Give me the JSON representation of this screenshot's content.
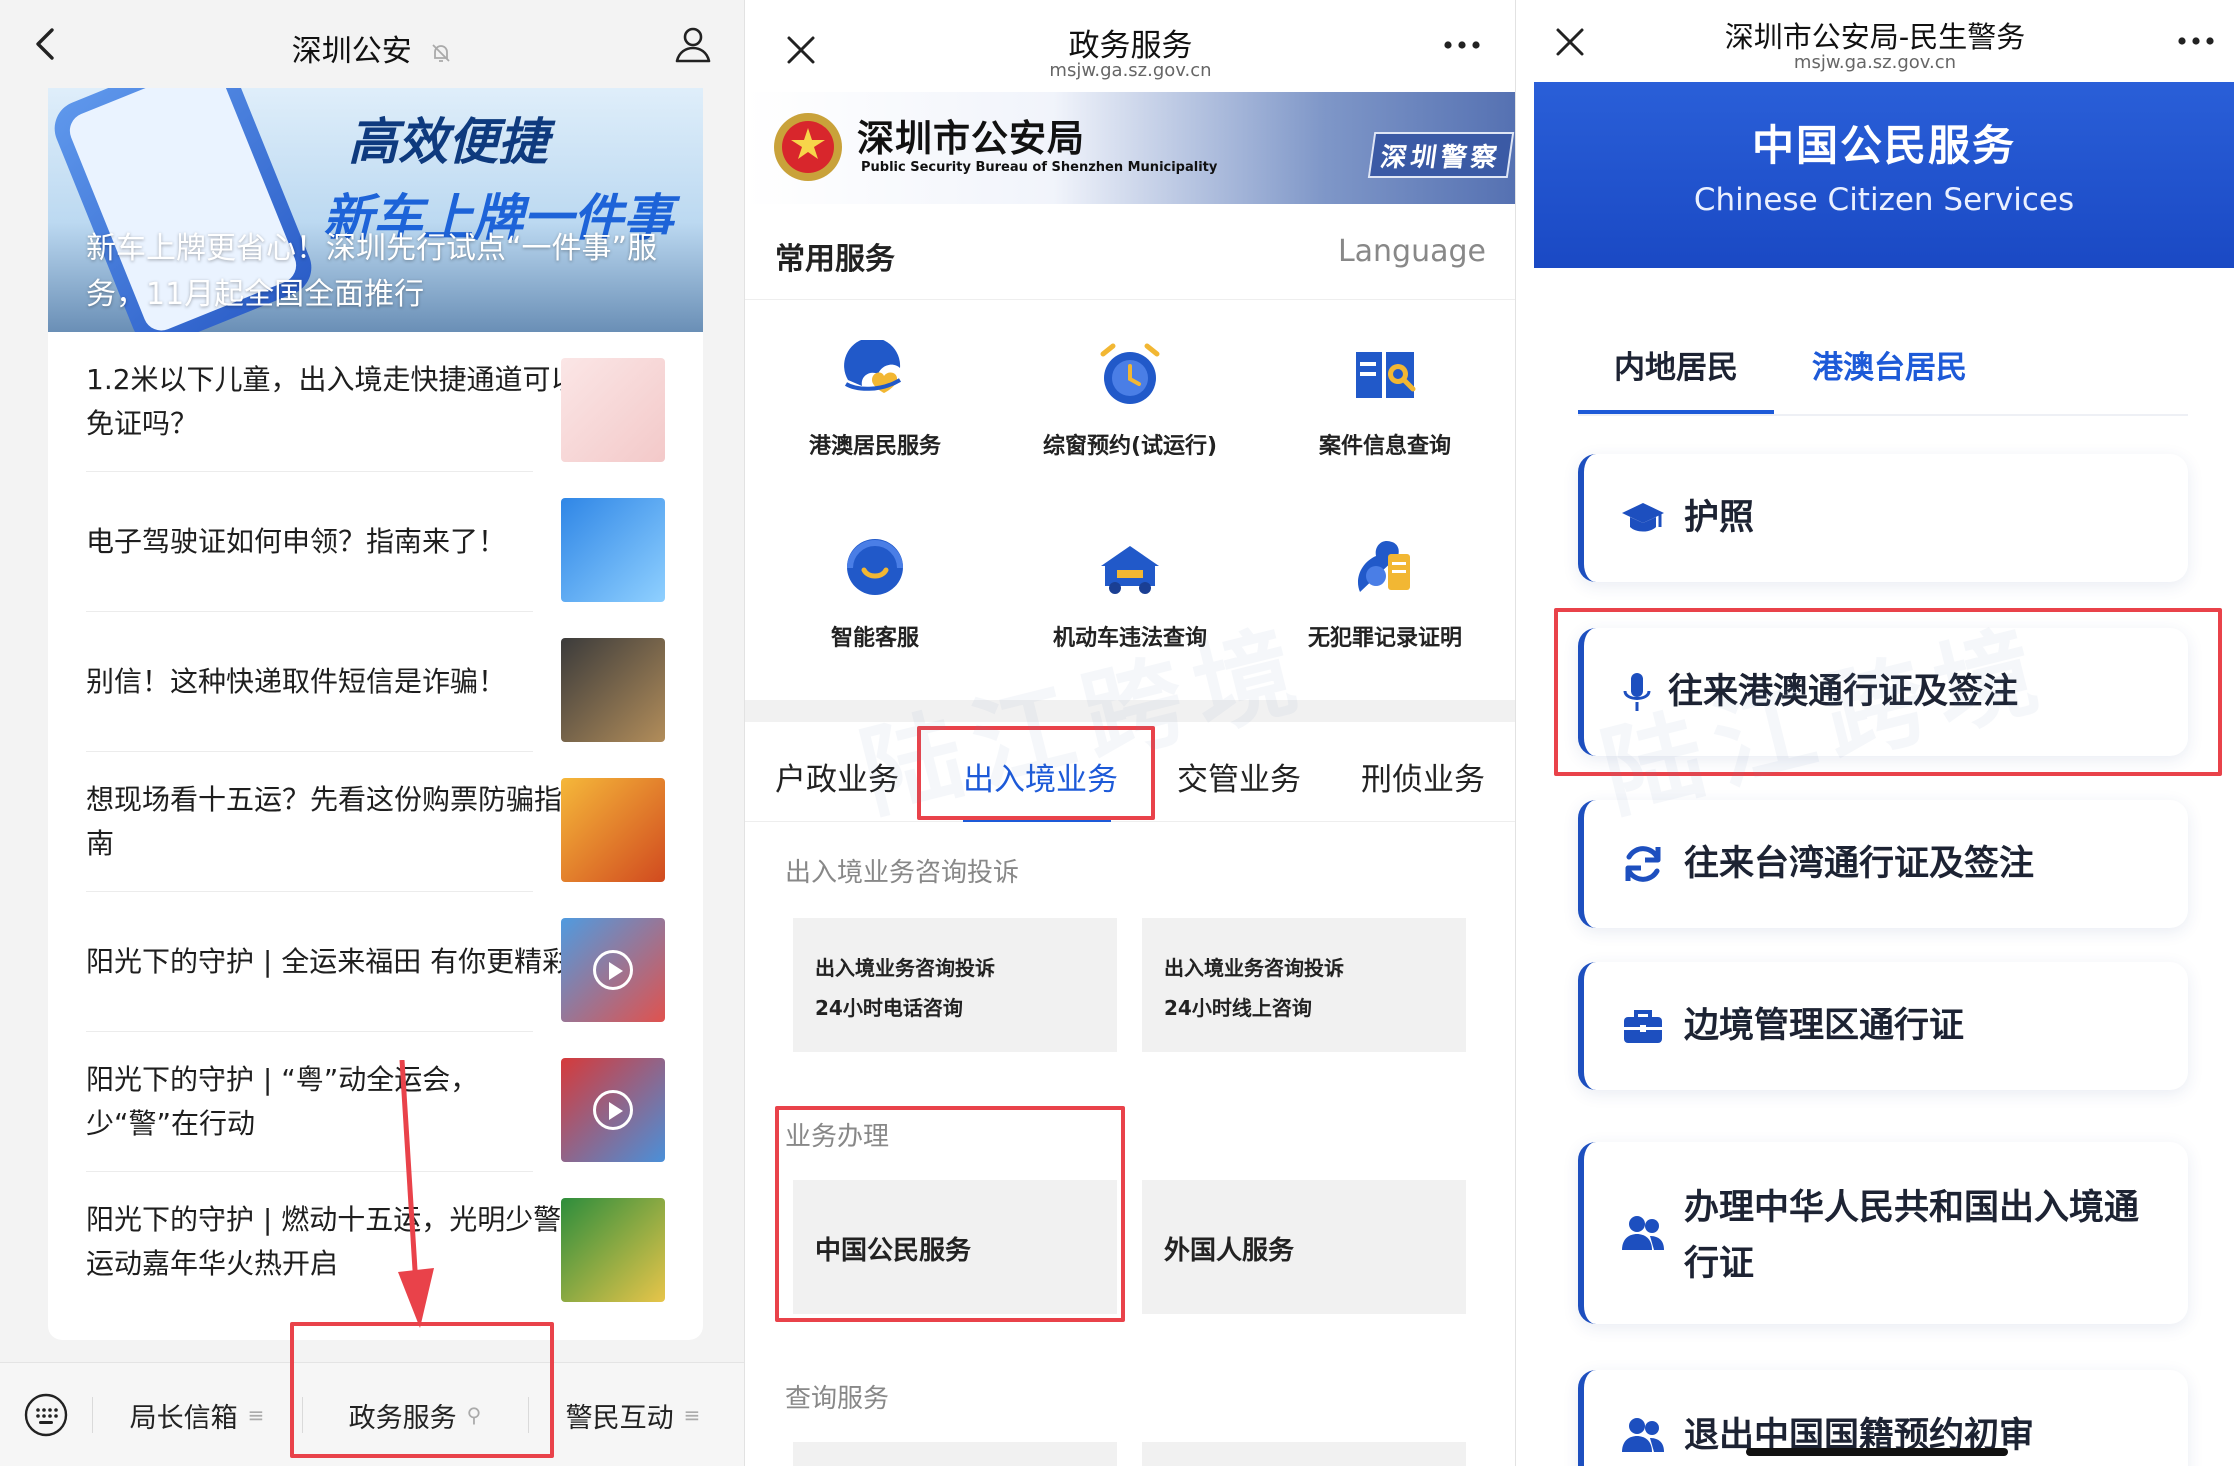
{
  "panel1": {
    "title": "深圳公安",
    "banner": {
      "headline": "高效便捷",
      "subheadline": "新车上牌一件事",
      "caption": "新车上牌更省心！深圳先行试点“一件事”服务，11月起全国全面推行"
    },
    "news": [
      {
        "title": "1.2米以下儿童，出入境走快捷通道可以免证吗？"
      },
      {
        "title": "电子驾驶证如何申领？指南来了！"
      },
      {
        "title": "别信！这种快递取件短信是诈骗！"
      },
      {
        "title": "想现场看十五运？先看这份购票防骗指南"
      },
      {
        "title": "阳光下的守护 | 全运来福田 有你更精彩"
      },
      {
        "title": "阳光下的守护 | “粤”动全运会，少“警”在行动"
      },
      {
        "title": "阳光下的守护 | 燃动十五运，光明少警运动嘉年华火热开启"
      }
    ],
    "tabbar": {
      "tab1": "局长信箱",
      "tab2": "政务服务",
      "tab3": "警民互动"
    }
  },
  "panel2": {
    "title": "政务服务",
    "url": "msjw.ga.sz.gov.cn",
    "bureau_cn": "深圳市公安局",
    "bureau_en": "Public Security Bureau of Shenzhen Municipality",
    "sign_text": "深圳警察",
    "section_title": "常用服务",
    "language": "Language",
    "services": [
      {
        "label": "港澳居民服务"
      },
      {
        "label": "综窗预约(试运行)"
      },
      {
        "label": "案件信息查询"
      },
      {
        "label": "智能客服"
      },
      {
        "label": "机动车违法查询"
      },
      {
        "label": "无犯罪记录证明"
      }
    ],
    "categories": [
      "户政业务",
      "出入境业务",
      "交管业务",
      "刑侦业务"
    ],
    "consult_header": "出入境业务咨询投诉",
    "consult_boxes": [
      {
        "line1": "出入境业务咨询投诉",
        "line2": "24小时电话咨询"
      },
      {
        "line1": "出入境业务咨询投诉",
        "line2": "24小时线上咨询"
      }
    ],
    "handle_header": "业务办理",
    "handle_boxes": [
      "中国公民服务",
      "外国人服务"
    ],
    "query_header": "查询服务"
  },
  "panel3": {
    "title": "深圳市公安局-民生警务",
    "url": "msjw.ga.sz.gov.cn",
    "hero_cn": "中国公民服务",
    "hero_en": "Chinese Citizen Services",
    "tabs": [
      "内地居民",
      "港澳台居民"
    ],
    "items": [
      {
        "label": "护照",
        "icon": "graduation-cap-icon"
      },
      {
        "label": "往来港澳通行证及签注",
        "icon": "microphone-icon"
      },
      {
        "label": "往来台湾通行证及签注",
        "icon": "refresh-icon"
      },
      {
        "label": "边境管理区通行证",
        "icon": "briefcase-icon"
      },
      {
        "label": "办理中华人民共和国出入境通行证",
        "icon": "users-icon"
      },
      {
        "label": "退出中国国籍预约初审",
        "icon": "users-icon"
      }
    ]
  },
  "colors": {
    "accent_blue": "#1d5ad8",
    "highlight_red": "#e9424a",
    "hero_blue": "#1a49c4"
  }
}
